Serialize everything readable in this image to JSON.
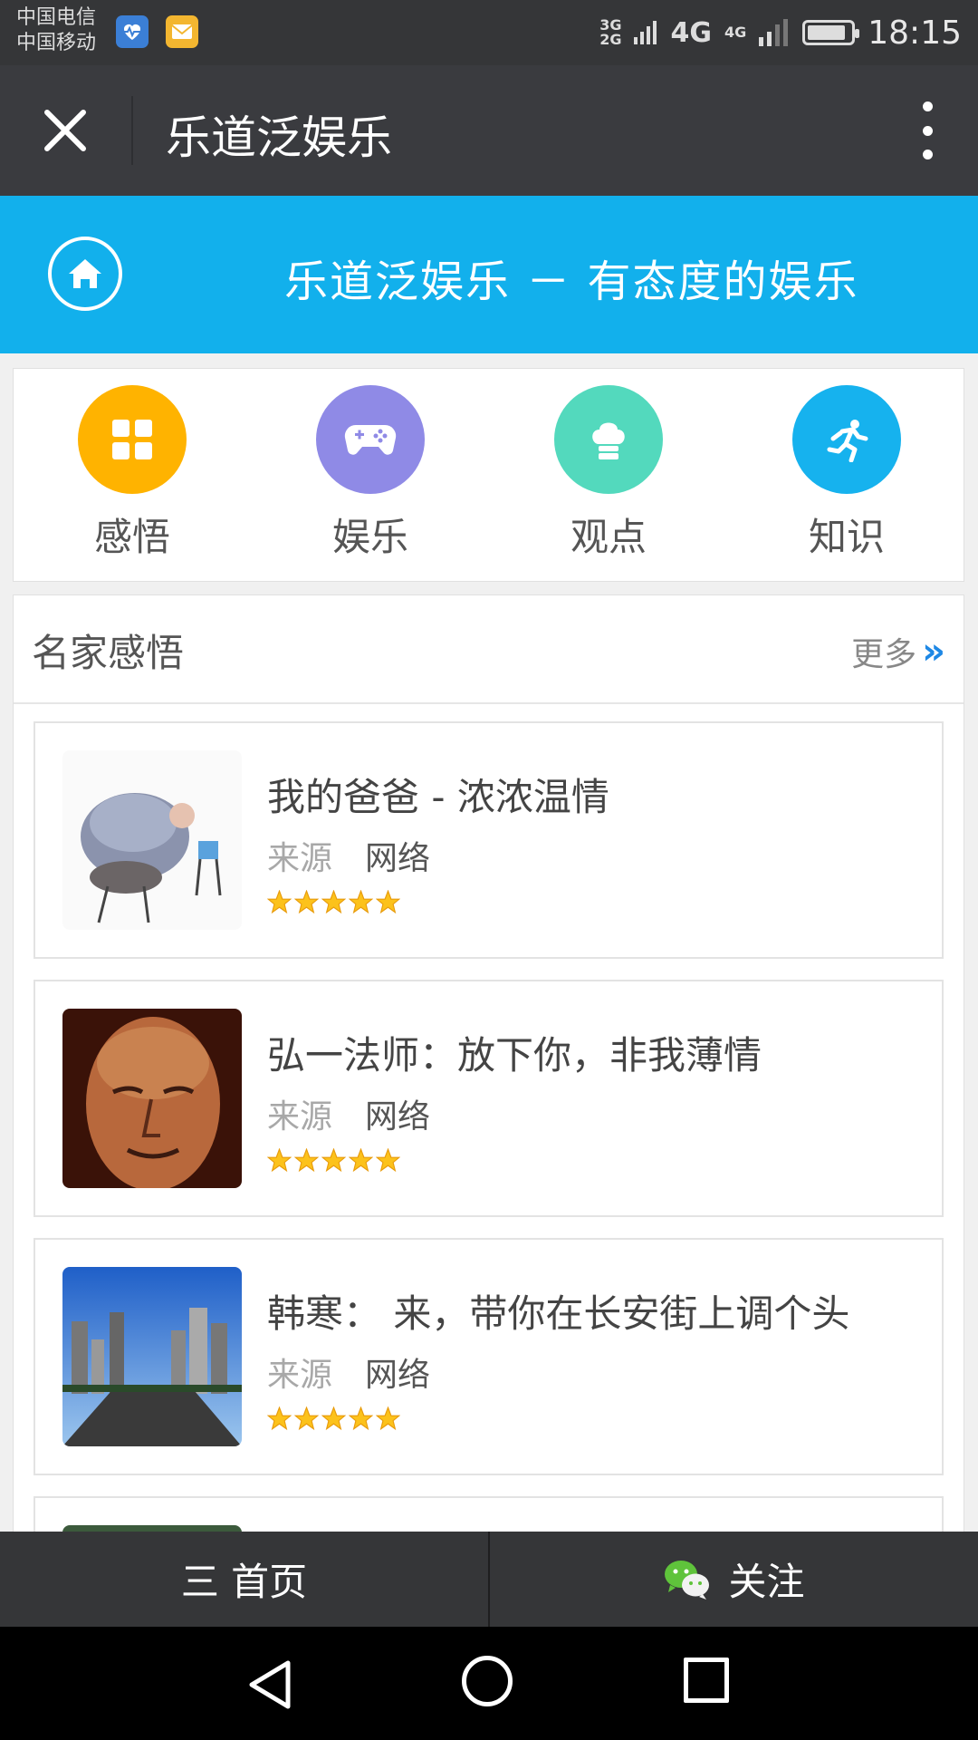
{
  "status_bar": {
    "carrier_1": "中国电信",
    "carrier_2": "中国移动",
    "network_small_top": "3G",
    "network_small_bottom": "2G",
    "network_main": "4G",
    "network_second": "4G",
    "time": "18:15",
    "battery_level": 0.85,
    "icons": [
      "health-app-icon",
      "mail-app-icon",
      "signal-icon",
      "battery-icon"
    ]
  },
  "title_bar": {
    "title": "乐道泛娱乐",
    "icons": [
      "close-icon",
      "more-vertical-icon"
    ]
  },
  "banner": {
    "title": "乐道泛娱乐 － 有态度的娱乐",
    "icon": "home-icon"
  },
  "categories": [
    {
      "label": "感悟",
      "icon": "grid-icon",
      "color": "#ffb300"
    },
    {
      "label": "娱乐",
      "icon": "gamepad-icon",
      "color": "#8f8ae6"
    },
    {
      "label": "观点",
      "icon": "chef-hat-icon",
      "color": "#53d9bd"
    },
    {
      "label": "知识",
      "icon": "running-icon",
      "color": "#16b2ee"
    }
  ],
  "section": {
    "title": "名家感悟",
    "more_label": "更多",
    "more_chevron": "»",
    "items": [
      {
        "title": "我的爸爸 - 浓浓温情",
        "source_label": "来源",
        "source": "网络",
        "rating": 5
      },
      {
        "title": "弘一法师：放下你，非我薄情",
        "source_label": "来源",
        "source": "网络",
        "rating": 5
      },
      {
        "title": "韩寒： 来，带你在长安街上调个头",
        "source_label": "来源",
        "source": "网络",
        "rating": 5
      }
    ]
  },
  "tab_bar": {
    "home_label": "三 首页",
    "follow_label": "关注",
    "follow_icon": "wechat-icon"
  },
  "nav_bar": {
    "icons": [
      "back-icon",
      "home-circle-icon",
      "recents-icon"
    ]
  }
}
